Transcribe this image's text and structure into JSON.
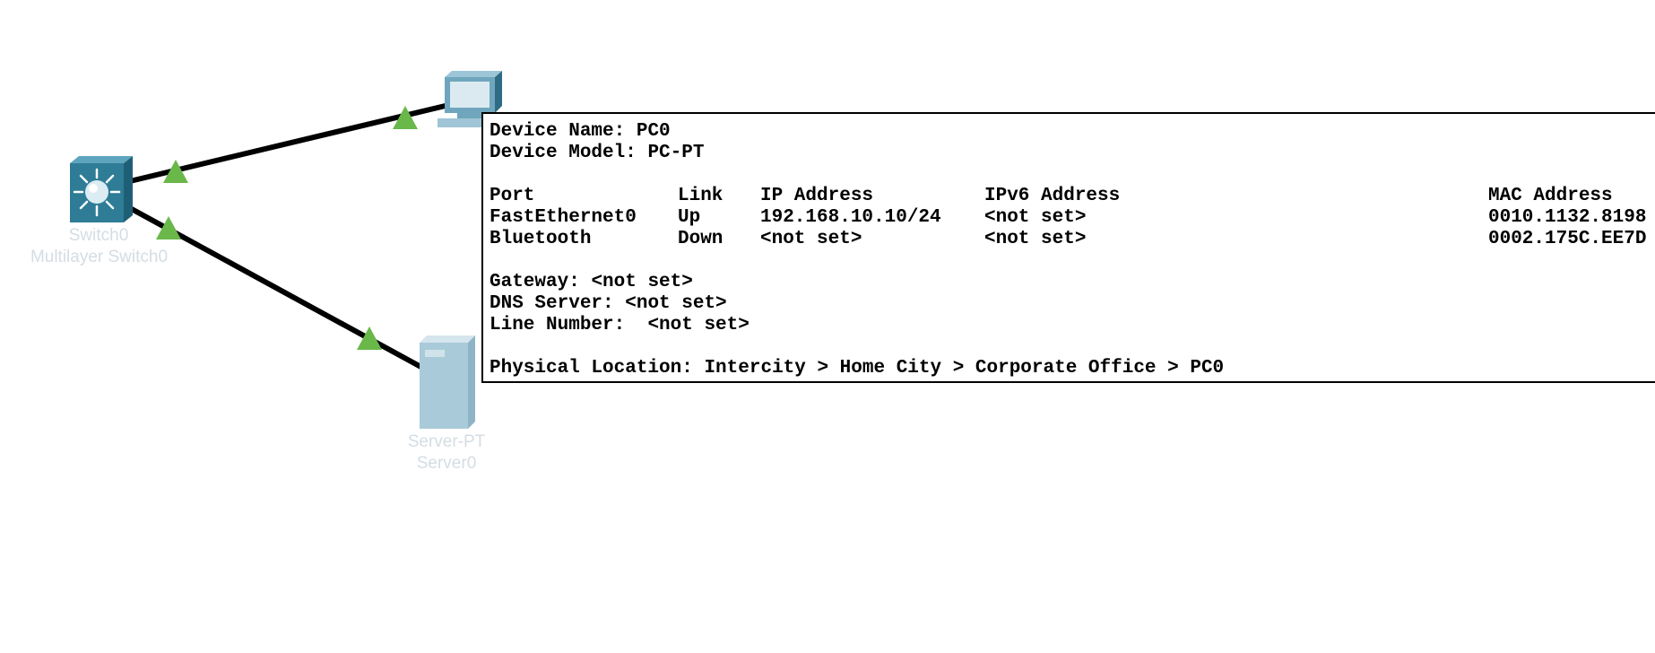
{
  "topology": {
    "switch": {
      "name": "Switch0",
      "model": "Multilayer Switch0"
    },
    "server": {
      "name": "Server-PT",
      "model": "Server0"
    },
    "pc": {
      "name": "PC-PT",
      "model": "PC0"
    },
    "colors": {
      "link": "#000000",
      "link_up": "#6ab84a",
      "switch": "#2e7c96",
      "server": "#a9cad9",
      "pc": "#6fa6bd"
    }
  },
  "info": {
    "device_name_label": "Device Name:",
    "device_name": "PC0",
    "device_model_label": "Device Model:",
    "device_model": "PC-PT",
    "columns": {
      "port": "Port",
      "link": "Link",
      "ip": "IP Address",
      "ipv6": "IPv6 Address",
      "mac": "MAC Address"
    },
    "rows": [
      {
        "port": "FastEthernet0",
        "link": "Up",
        "ip": "192.168.10.10/24",
        "ipv6": "<not set>",
        "mac": "0010.1132.8198"
      },
      {
        "port": "Bluetooth",
        "link": "Down",
        "ip": "<not set>",
        "ipv6": "<not set>",
        "mac": "0002.175C.EE7D"
      }
    ],
    "gateway_label": "Gateway:",
    "gateway": "<not set>",
    "dns_label": "DNS Server:",
    "dns": "<not set>",
    "line_number_label": "Line Number: ",
    "line_number": "<not set>",
    "location_label": "Physical Location:",
    "location": "Intercity > Home City > Corporate Office > PC0"
  }
}
